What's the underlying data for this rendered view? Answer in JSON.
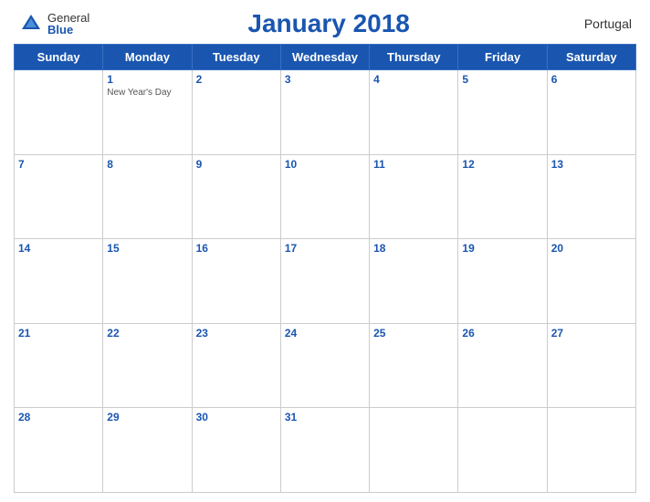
{
  "header": {
    "logo_general": "General",
    "logo_blue": "Blue",
    "title": "January 2018",
    "country": "Portugal"
  },
  "weekdays": [
    "Sunday",
    "Monday",
    "Tuesday",
    "Wednesday",
    "Thursday",
    "Friday",
    "Saturday"
  ],
  "weeks": [
    [
      {
        "num": "",
        "holiday": ""
      },
      {
        "num": "1",
        "holiday": "New Year's Day"
      },
      {
        "num": "2",
        "holiday": ""
      },
      {
        "num": "3",
        "holiday": ""
      },
      {
        "num": "4",
        "holiday": ""
      },
      {
        "num": "5",
        "holiday": ""
      },
      {
        "num": "6",
        "holiday": ""
      }
    ],
    [
      {
        "num": "7",
        "holiday": ""
      },
      {
        "num": "8",
        "holiday": ""
      },
      {
        "num": "9",
        "holiday": ""
      },
      {
        "num": "10",
        "holiday": ""
      },
      {
        "num": "11",
        "holiday": ""
      },
      {
        "num": "12",
        "holiday": ""
      },
      {
        "num": "13",
        "holiday": ""
      }
    ],
    [
      {
        "num": "14",
        "holiday": ""
      },
      {
        "num": "15",
        "holiday": ""
      },
      {
        "num": "16",
        "holiday": ""
      },
      {
        "num": "17",
        "holiday": ""
      },
      {
        "num": "18",
        "holiday": ""
      },
      {
        "num": "19",
        "holiday": ""
      },
      {
        "num": "20",
        "holiday": ""
      }
    ],
    [
      {
        "num": "21",
        "holiday": ""
      },
      {
        "num": "22",
        "holiday": ""
      },
      {
        "num": "23",
        "holiday": ""
      },
      {
        "num": "24",
        "holiday": ""
      },
      {
        "num": "25",
        "holiday": ""
      },
      {
        "num": "26",
        "holiday": ""
      },
      {
        "num": "27",
        "holiday": ""
      }
    ],
    [
      {
        "num": "28",
        "holiday": ""
      },
      {
        "num": "29",
        "holiday": ""
      },
      {
        "num": "30",
        "holiday": ""
      },
      {
        "num": "31",
        "holiday": ""
      },
      {
        "num": "",
        "holiday": ""
      },
      {
        "num": "",
        "holiday": ""
      },
      {
        "num": "",
        "holiday": ""
      }
    ]
  ]
}
